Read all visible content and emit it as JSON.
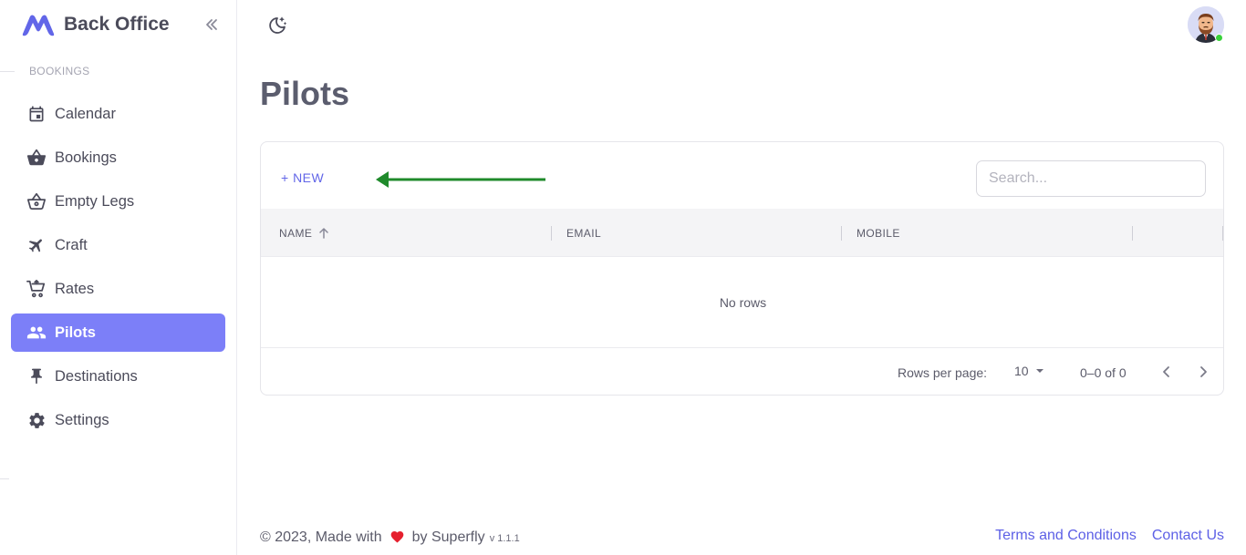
{
  "brand": {
    "name": "Back Office",
    "logo_icon": "m-logo-icon",
    "accent": "#6266e8"
  },
  "sidebar": {
    "section_label": "BOOKINGS",
    "items": [
      {
        "label": "Calendar",
        "icon": "calendar-icon",
        "active": false
      },
      {
        "label": "Bookings",
        "icon": "basket-icon",
        "active": false
      },
      {
        "label": "Empty Legs",
        "icon": "basket-outline-icon",
        "active": false
      },
      {
        "label": "Craft",
        "icon": "airplane-icon",
        "active": false
      },
      {
        "label": "Rates",
        "icon": "cart-icon",
        "active": false
      },
      {
        "label": "Pilots",
        "icon": "people-icon",
        "active": true
      },
      {
        "label": "Destinations",
        "icon": "pin-icon",
        "active": false
      },
      {
        "label": "Settings",
        "icon": "gear-icon",
        "active": false
      }
    ],
    "active_color": "#7c7ff8"
  },
  "header": {
    "theme_icon": "moon-stars-icon",
    "avatar_icon": "avatar-icon",
    "status_color": "#38d13a"
  },
  "page": {
    "title": "Pilots"
  },
  "table": {
    "new_label": "+ NEW",
    "search_placeholder": "Search...",
    "columns": [
      {
        "label": "NAME",
        "sorted": "asc"
      },
      {
        "label": "EMAIL"
      },
      {
        "label": "MOBILE"
      }
    ],
    "empty_text": "No rows",
    "rows_per_page_label": "Rows per page:",
    "rows_per_page_value": "10",
    "range_text": "0–0 of 0"
  },
  "annotation": {
    "arrow_color": "#1f8a2b"
  },
  "footer": {
    "copyright_prefix": "© 2023, Made with",
    "copyright_suffix": "by Superfly",
    "version": "v 1.1.1",
    "links": [
      "Terms and Conditions",
      "Contact Us"
    ]
  }
}
